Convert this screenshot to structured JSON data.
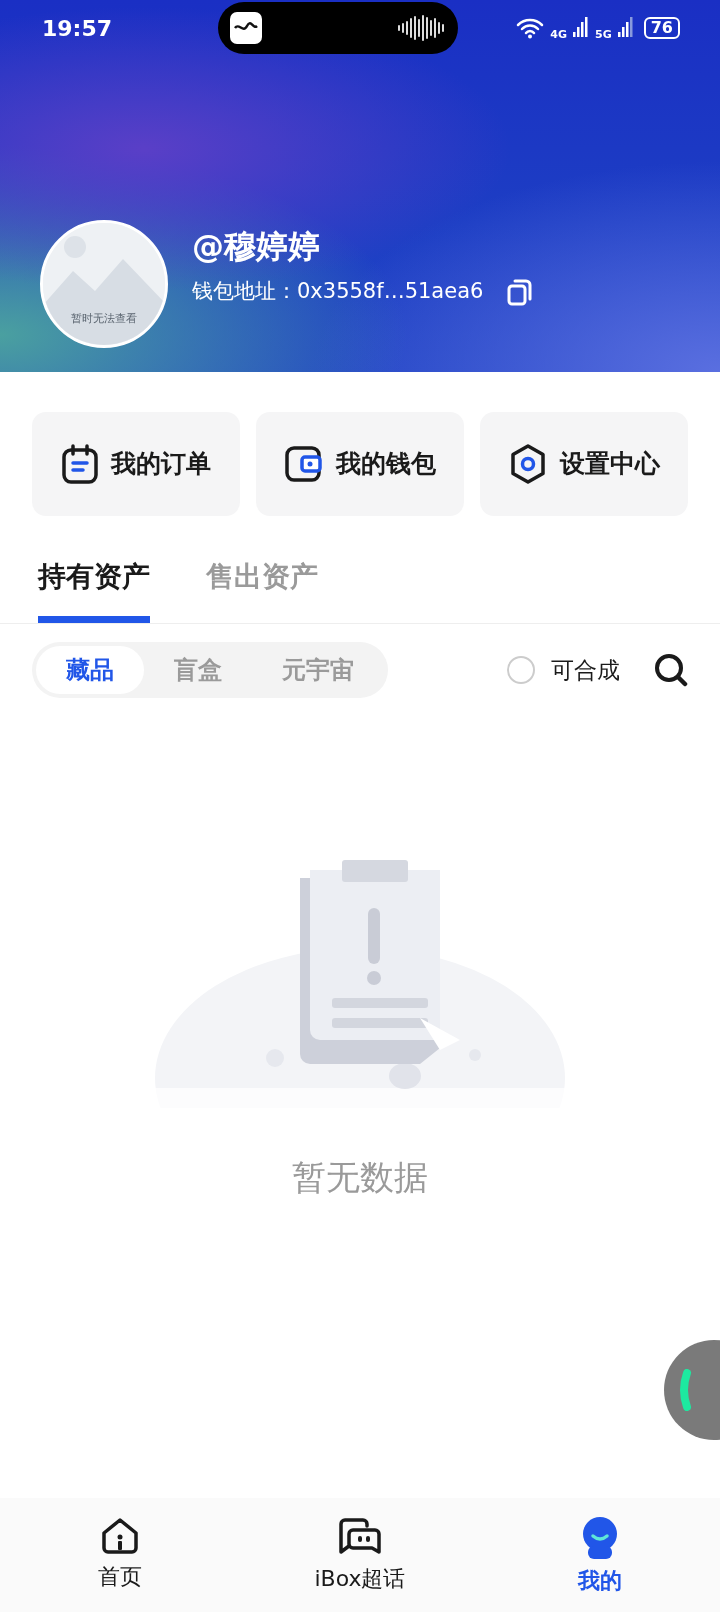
{
  "status_bar": {
    "time": "19:57",
    "network_1": "4G",
    "network_2": "5G",
    "battery": "76"
  },
  "profile": {
    "avatar_caption": "暂时无法查看",
    "name": "@穆婷婷",
    "wallet_label": "钱包地址：",
    "wallet_address": "0x3558f…51aea6"
  },
  "quick_actions": [
    {
      "kind": "orders",
      "label": "我的订单"
    },
    {
      "kind": "wallet",
      "label": "我的钱包"
    },
    {
      "kind": "settings",
      "label": "设置中心"
    }
  ],
  "tabs": [
    {
      "label": "持有资产",
      "selected": true
    },
    {
      "label": "售出资产",
      "selected": false
    }
  ],
  "segments": [
    {
      "label": "藏品",
      "selected": true
    },
    {
      "label": "盲盒",
      "selected": false
    },
    {
      "label": "元宇宙",
      "selected": false
    }
  ],
  "composable_filter": {
    "label": "可合成",
    "checked": false
  },
  "empty_state": {
    "message": "暂无数据"
  },
  "bottom_nav": [
    {
      "kind": "home",
      "label": "首页",
      "selected": false
    },
    {
      "kind": "chat",
      "label": "iBox超话",
      "selected": false
    },
    {
      "kind": "me",
      "label": "我的",
      "selected": true
    }
  ]
}
